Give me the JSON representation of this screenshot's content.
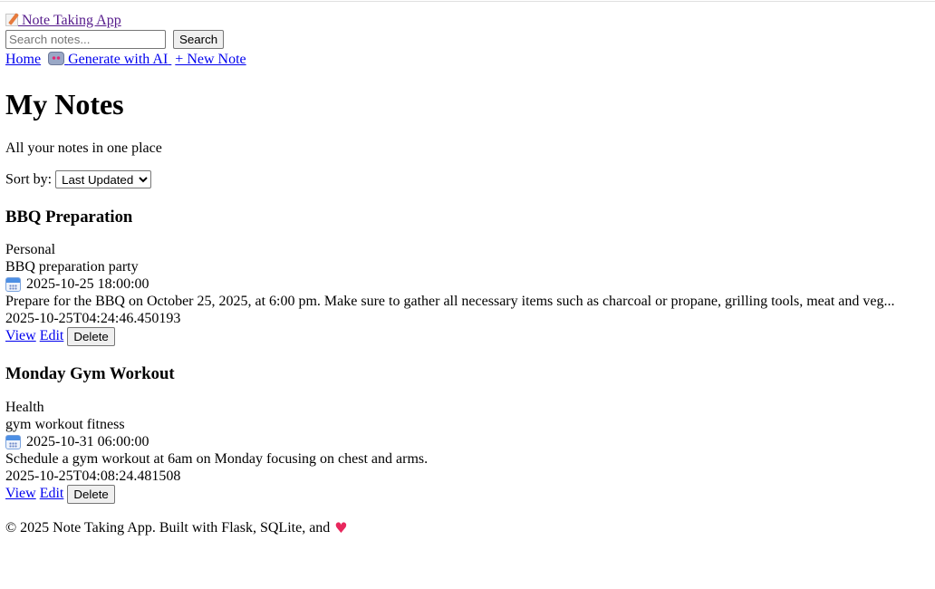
{
  "header": {
    "brand_label": "Note Taking App",
    "brand_icon": "memo-icon",
    "search": {
      "placeholder": "Search notes...",
      "value": "",
      "button_label": "Search"
    },
    "nav": {
      "home_label": "Home",
      "generate_label": "Generate with AI",
      "generate_icon": "robot-icon",
      "new_note_label": "+ New Note"
    }
  },
  "main": {
    "title": "My Notes",
    "subtitle": "All your notes in one place",
    "sort": {
      "label": "Sort by:",
      "selected": "Last Updated"
    },
    "notes": [
      {
        "title": "BBQ Preparation",
        "category": "Personal",
        "tags": "BBQ preparation party",
        "scheduled": "2025-10-25 18:00:00",
        "excerpt": "Prepare for the BBQ on October 25, 2025, at 6:00 pm. Make sure to gather all necessary items such as charcoal or propane, grilling tools, meat and veg...",
        "updated": "2025-10-25T04:24:46.450193",
        "view_label": "View",
        "edit_label": "Edit",
        "delete_label": "Delete"
      },
      {
        "title": "Monday Gym Workout",
        "category": "Health",
        "tags": "gym workout fitness",
        "scheduled": "2025-10-31 06:00:00",
        "excerpt": "Schedule a gym workout at 6am on Monday focusing on chest and arms.",
        "updated": "2025-10-25T04:08:24.481508",
        "view_label": "View",
        "edit_label": "Edit",
        "delete_label": "Delete"
      }
    ]
  },
  "footer": {
    "text": "© 2025 Note Taking App. Built with Flask, SQLite, and",
    "heart_icon": "heart-icon",
    "heart_color": "#e8275d"
  },
  "colors": {
    "link": "#0000ee",
    "visited_link": "#551a8b"
  }
}
